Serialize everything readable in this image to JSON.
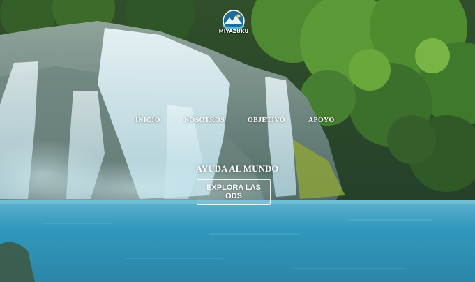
{
  "brand": {
    "logo_text": "MIYAZUKU"
  },
  "nav": {
    "items": [
      {
        "label": "INICIO"
      },
      {
        "label": "NOSOTROS"
      },
      {
        "label": "OBJETIVO"
      },
      {
        "label": "APOYO"
      }
    ]
  },
  "hero": {
    "headline": "AYUDA AL MUNDO",
    "cta_label": "EXPLORA LAS ODS"
  },
  "colors": {
    "water": "#2f95b8",
    "foliage": "#3d6a2e",
    "text": "#ffffff"
  }
}
